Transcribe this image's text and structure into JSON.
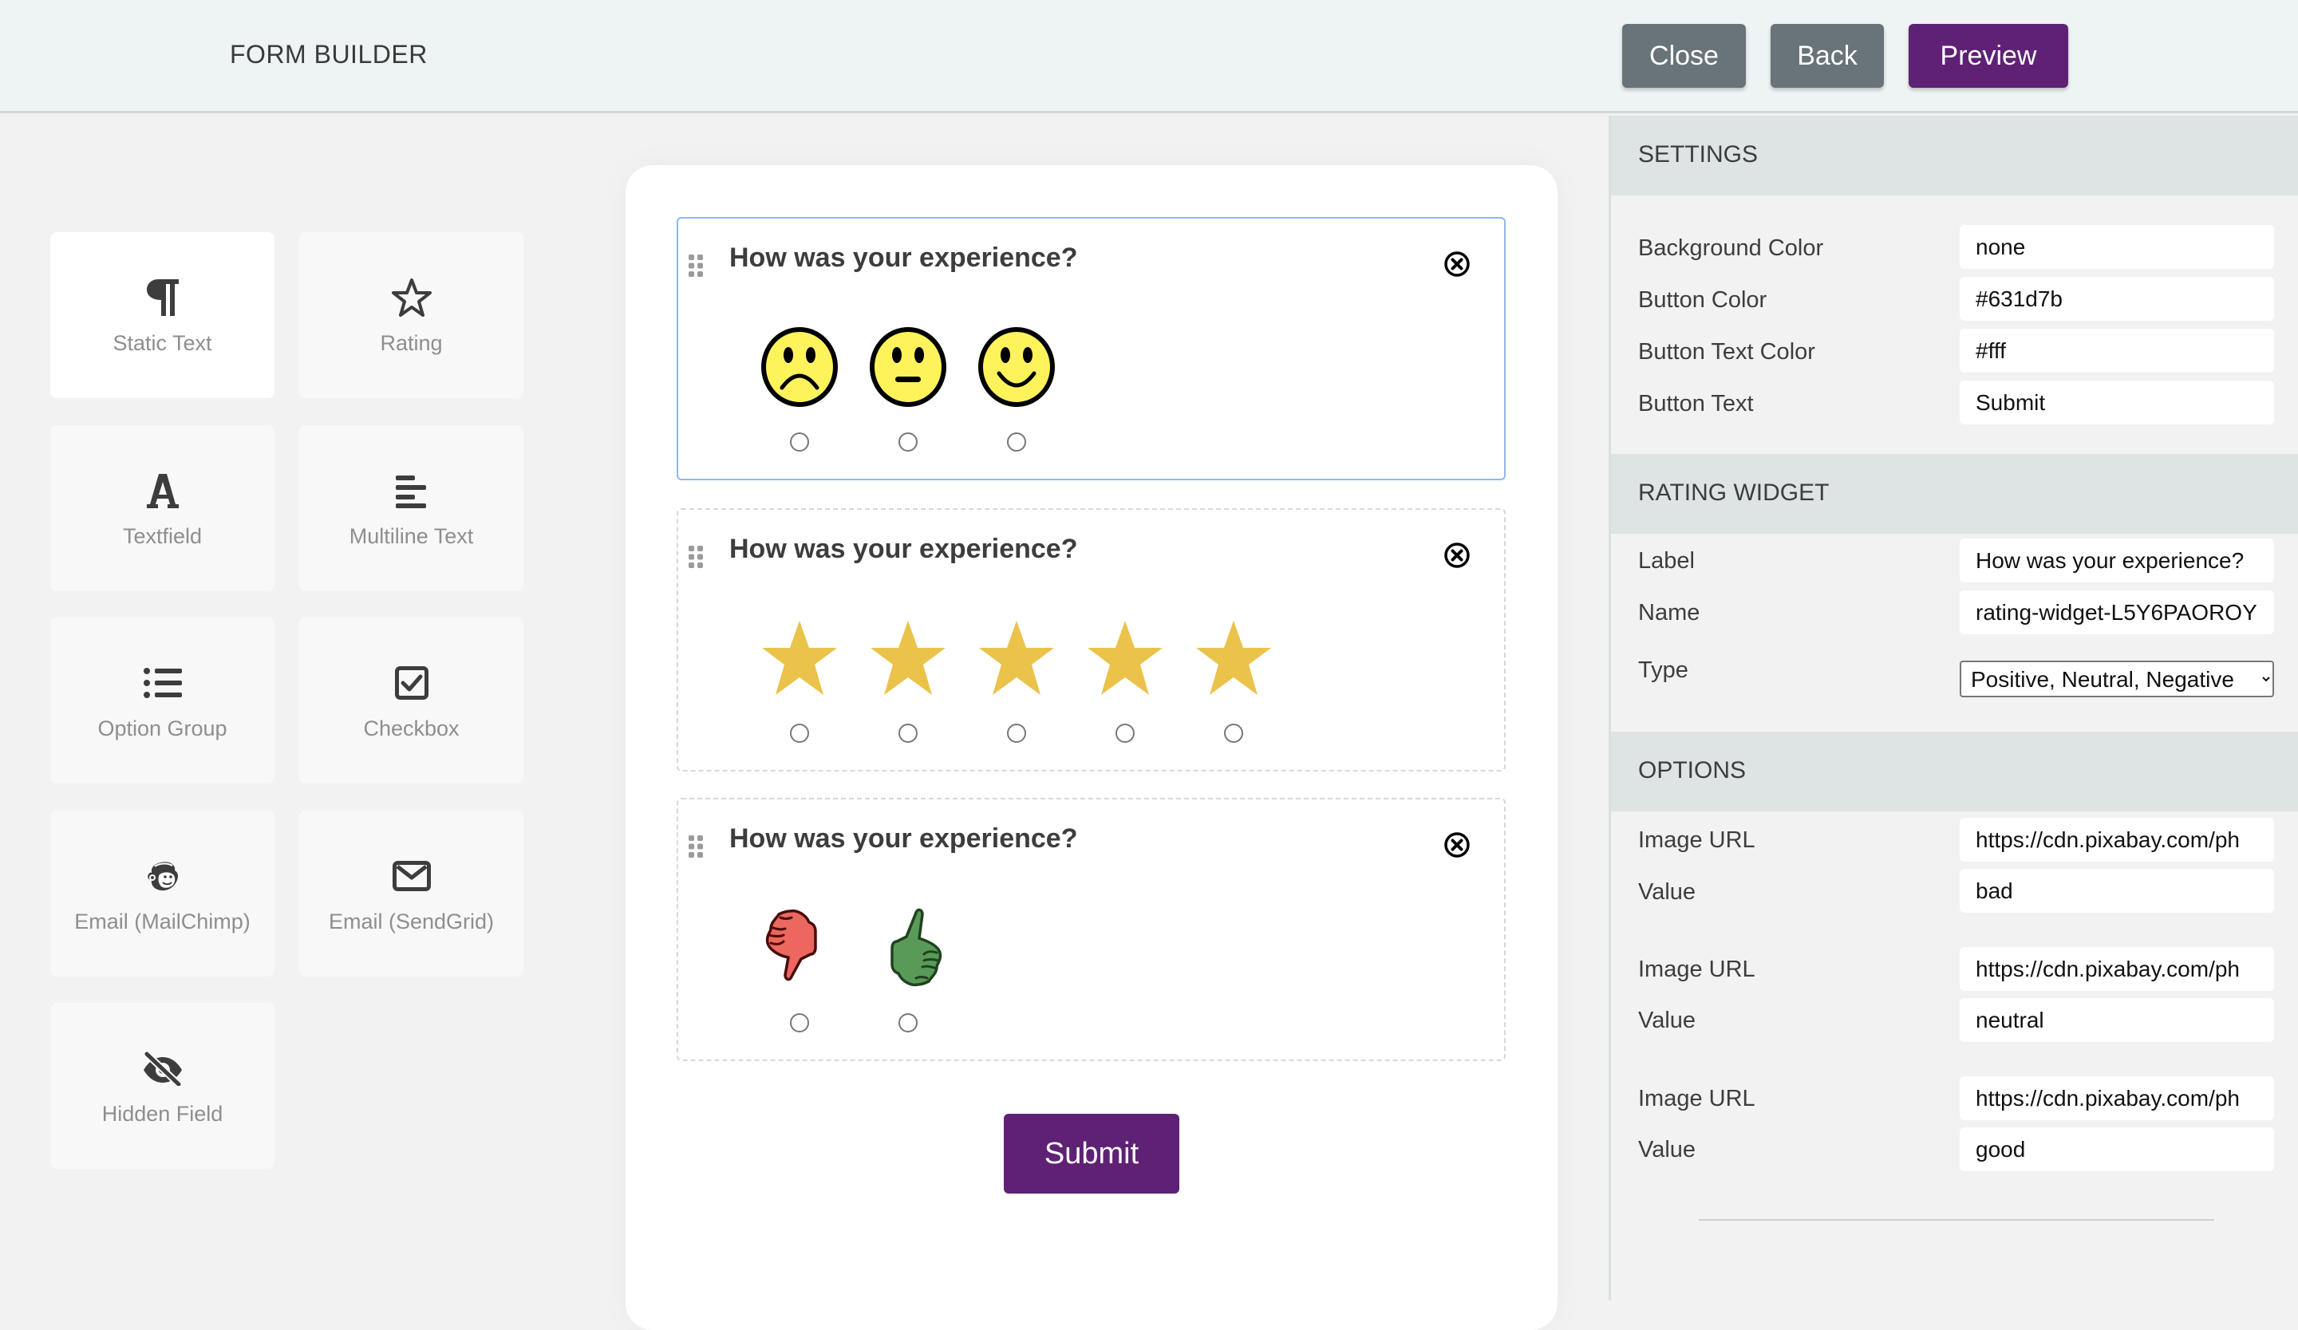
{
  "header": {
    "title": "FORM BUILDER",
    "buttons": {
      "close": "Close",
      "back": "Back",
      "preview": "Preview"
    }
  },
  "palette": {
    "items": [
      {
        "label": "Static Text",
        "icon": "paragraph-icon"
      },
      {
        "label": "Rating",
        "icon": "star-outline-icon"
      },
      {
        "label": "Textfield",
        "icon": "letter-a-icon"
      },
      {
        "label": "Multiline Text",
        "icon": "align-left-icon"
      },
      {
        "label": "Option Group",
        "icon": "list-icon"
      },
      {
        "label": "Checkbox",
        "icon": "checkbox-icon"
      },
      {
        "label": "Email (MailChimp)",
        "icon": "mailchimp-icon"
      },
      {
        "label": "Email (SendGrid)",
        "icon": "envelope-icon"
      },
      {
        "label": "Hidden Field",
        "icon": "eye-slash-icon"
      }
    ]
  },
  "canvas": {
    "widgets": [
      {
        "title": "How was your experience?",
        "type": "smileys",
        "options": [
          "sad-face",
          "neutral-face",
          "happy-face"
        ],
        "selected": true
      },
      {
        "title": "How was your experience?",
        "type": "stars",
        "options": [
          "star",
          "star",
          "star",
          "star",
          "star"
        ],
        "selected": false
      },
      {
        "title": "How was your experience?",
        "type": "thumbs",
        "options": [
          "thumbs-down",
          "thumbs-up"
        ],
        "selected": false
      }
    ],
    "submit_label": "Submit"
  },
  "colors": {
    "accent": "#5e2174",
    "secondary_button": "#68747a",
    "star": "#ebc24a",
    "smiley": "#fff35c",
    "thumbs_down": "#ec6760",
    "thumbs_up": "#5a9a58",
    "selected_border": "#8fb7ef"
  },
  "settings": {
    "heading": "SETTINGS",
    "fields": [
      {
        "label": "Background Color",
        "value": "none"
      },
      {
        "label": "Button Color",
        "value": "#631d7b"
      },
      {
        "label": "Button Text Color",
        "value": "#fff"
      },
      {
        "label": "Button Text",
        "value": "Submit"
      }
    ]
  },
  "rating_widget": {
    "heading": "RATING WIDGET",
    "label_label": "Label",
    "label_value": "How was your experience?",
    "name_label": "Name",
    "name_value": "rating-widget-L5Y6PAOROY",
    "type_label": "Type",
    "type_value": "Positive, Neutral, Negative"
  },
  "options": {
    "heading": "OPTIONS",
    "items": [
      {
        "url_label": "Image URL",
        "url_value": "https://cdn.pixabay.com/ph",
        "value_label": "Value",
        "value": "bad"
      },
      {
        "url_label": "Image URL",
        "url_value": "https://cdn.pixabay.com/ph",
        "value_label": "Value",
        "value": "neutral"
      },
      {
        "url_label": "Image URL",
        "url_value": "https://cdn.pixabay.com/ph",
        "value_label": "Value",
        "value": "good"
      }
    ]
  }
}
